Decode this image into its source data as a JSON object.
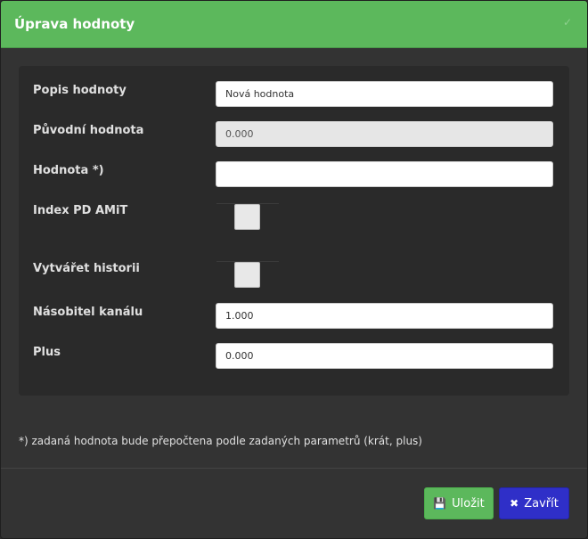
{
  "dialog": {
    "title": "Úprava hodnoty",
    "close_glyph": "✓"
  },
  "form": {
    "description": {
      "label": "Popis hodnoty",
      "value": "Nová hodnota"
    },
    "original_value": {
      "label": "Původní hodnota",
      "value": "0.000"
    },
    "value": {
      "label": "Hodnota *)",
      "value": ""
    },
    "index_pd_amit": {
      "label": "Index PD AMiT",
      "checked": false
    },
    "create_history": {
      "label": "Vytvářet historii",
      "checked": false
    },
    "channel_multiplier": {
      "label": "Násobitel kanálu",
      "value": "1.000"
    },
    "plus": {
      "label": "Plus",
      "value": "0.000"
    }
  },
  "footnote": "*) zadaná hodnota bude přepočtena podle zadaných parametrů (krát, plus)",
  "buttons": {
    "save": {
      "label": "Uložit",
      "icon": "floppy-disk-icon",
      "glyph": "💾"
    },
    "close": {
      "label": "Zavřít",
      "icon": "times-icon",
      "glyph": "✖"
    }
  },
  "colors": {
    "header": "#5cb85c",
    "save_button": "#5cb85c",
    "close_button": "#2f2fc8",
    "panel": "#2a2a2a",
    "modal": "#333333"
  }
}
